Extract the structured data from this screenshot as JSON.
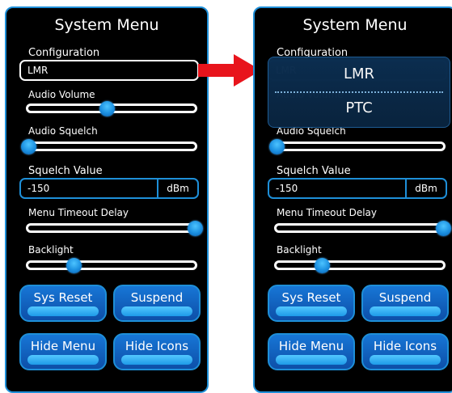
{
  "menu": {
    "title": "System Menu",
    "configuration_label": "Configuration",
    "configuration_value": "LMR",
    "audio_volume_label": "Audio Volume",
    "audio_volume_level": 0.47,
    "audio_squelch_label": "Audio Squelch",
    "audio_squelch_level": 0.0,
    "squelch_value_label": "Squelch Value",
    "squelch_value": "-150",
    "squelch_unit": "dBm",
    "menu_timeout_label": "Menu Timeout Delay",
    "menu_timeout_level": 1.0,
    "backlight_label": "Backlight",
    "backlight_level": 0.27
  },
  "buttons": {
    "sys_reset": "Sys Reset",
    "suspend": "Suspend",
    "hide_menu": "Hide Menu",
    "hide_icons": "Hide Icons"
  },
  "dropdown": {
    "options": [
      "LMR",
      "PTC"
    ]
  },
  "colors": {
    "accent": "#1e8fd8",
    "arrow": "#e8141c",
    "panel_bg": "#000000"
  }
}
